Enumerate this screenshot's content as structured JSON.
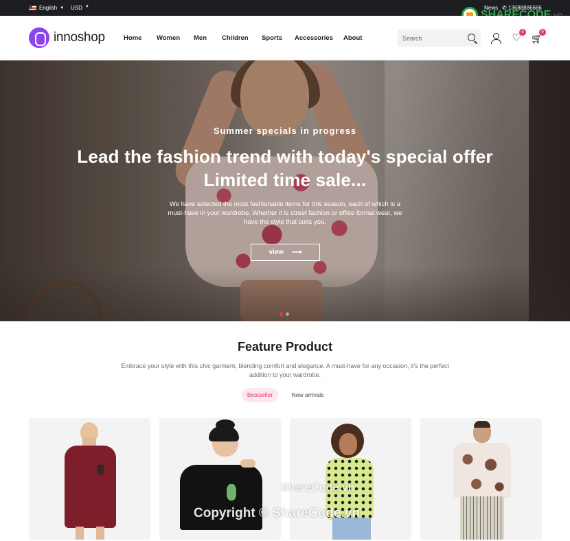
{
  "topbar": {
    "language": "English",
    "currency": "USD",
    "news": "News",
    "phone": "13688886666"
  },
  "brand": {
    "name": "innoshop"
  },
  "nav": [
    "Home",
    "Women",
    "Men",
    "Children",
    "Sports",
    "Accessories",
    "About"
  ],
  "search": {
    "placeholder": "Search"
  },
  "header_icons": {
    "wishlist_count": "0",
    "cart_count": "0"
  },
  "hero": {
    "subtitle": "Summer specials in progress",
    "title_line1": "Lead the fashion trend with today's special offer",
    "title_line2": "Limited time sale...",
    "description": "We have selected the most fashionable items for this season, each of which is a must-have in your wardrobe. Whether it is street fashion or office formal wear, we have the style that suits you.",
    "button_label": "view"
  },
  "feature": {
    "title": "Feature Product",
    "description": "Embrace your style with this chic garment, blending comfort and elegance. A must-have for any occasion, it's the perfect addition to your wardrobe.",
    "tabs": [
      "Bestseller",
      "New arrivals"
    ]
  },
  "watermarks": {
    "logo_main": "SHARECODE",
    "logo_tld": ".vn",
    "small": "ShareCode.vn",
    "large": "Copyright © ShareCode.vn"
  },
  "colors": {
    "accent": "#e8336b",
    "brand": "#8e44ec",
    "topbar": "#1c1e21"
  }
}
